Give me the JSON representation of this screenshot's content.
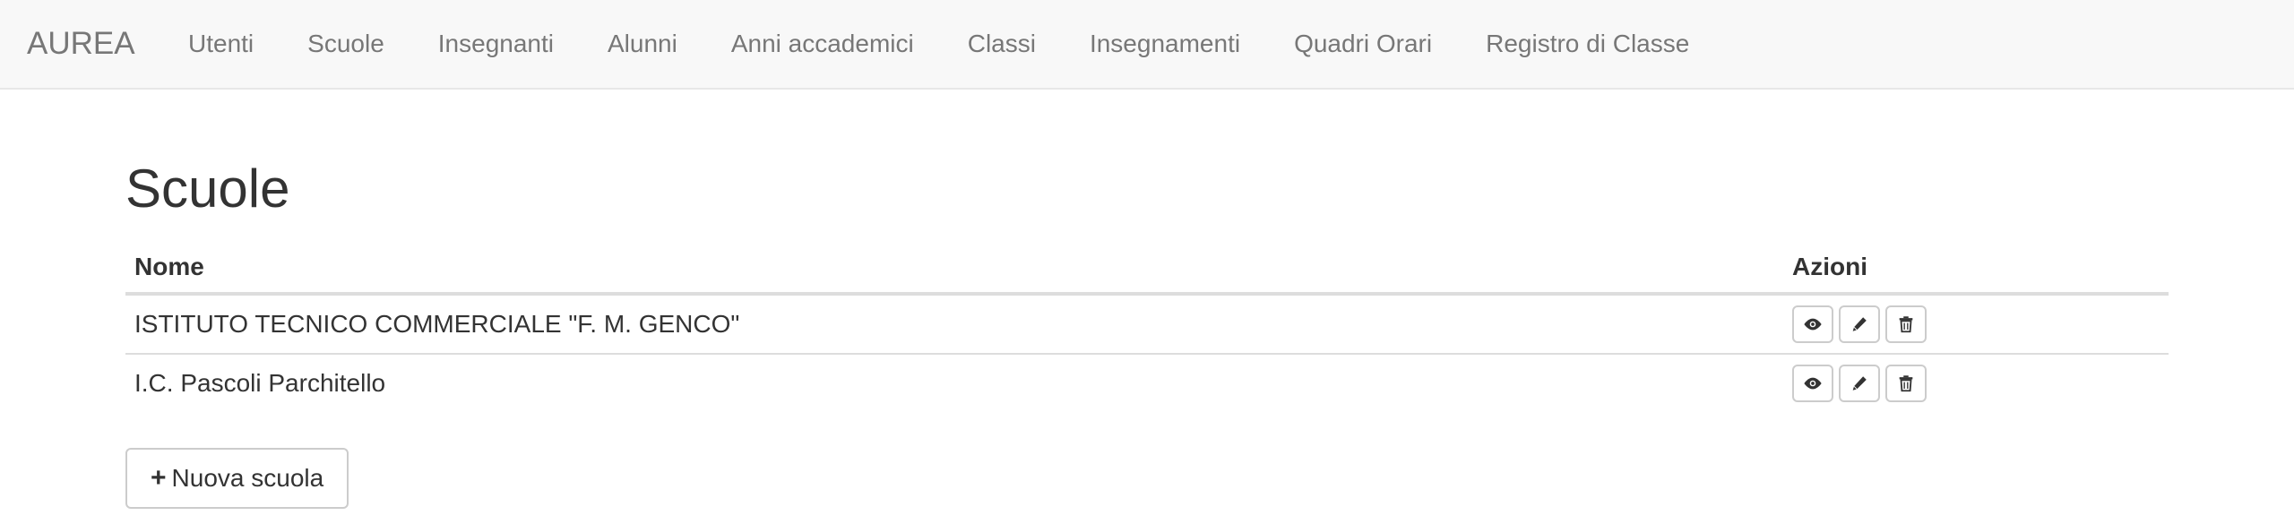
{
  "navbar": {
    "brand": "AUREA",
    "items": [
      {
        "label": "Utenti"
      },
      {
        "label": "Scuole"
      },
      {
        "label": "Insegnanti"
      },
      {
        "label": "Alunni"
      },
      {
        "label": "Anni accademici"
      },
      {
        "label": "Classi"
      },
      {
        "label": "Insegnamenti"
      },
      {
        "label": "Quadri Orari"
      },
      {
        "label": "Registro di Classe"
      }
    ]
  },
  "page": {
    "title": "Scuole"
  },
  "table": {
    "headers": {
      "name": "Nome",
      "actions": "Azioni"
    },
    "rows": [
      {
        "name": "ISTITUTO TECNICO COMMERCIALE \"F. M. GENCO\""
      },
      {
        "name": "I.C. Pascoli Parchitello"
      }
    ],
    "action_icons": [
      "eye-icon",
      "pencil-icon",
      "trash-icon"
    ]
  },
  "new_button": {
    "icon": "plus-icon",
    "label": "Nuova scuola"
  }
}
